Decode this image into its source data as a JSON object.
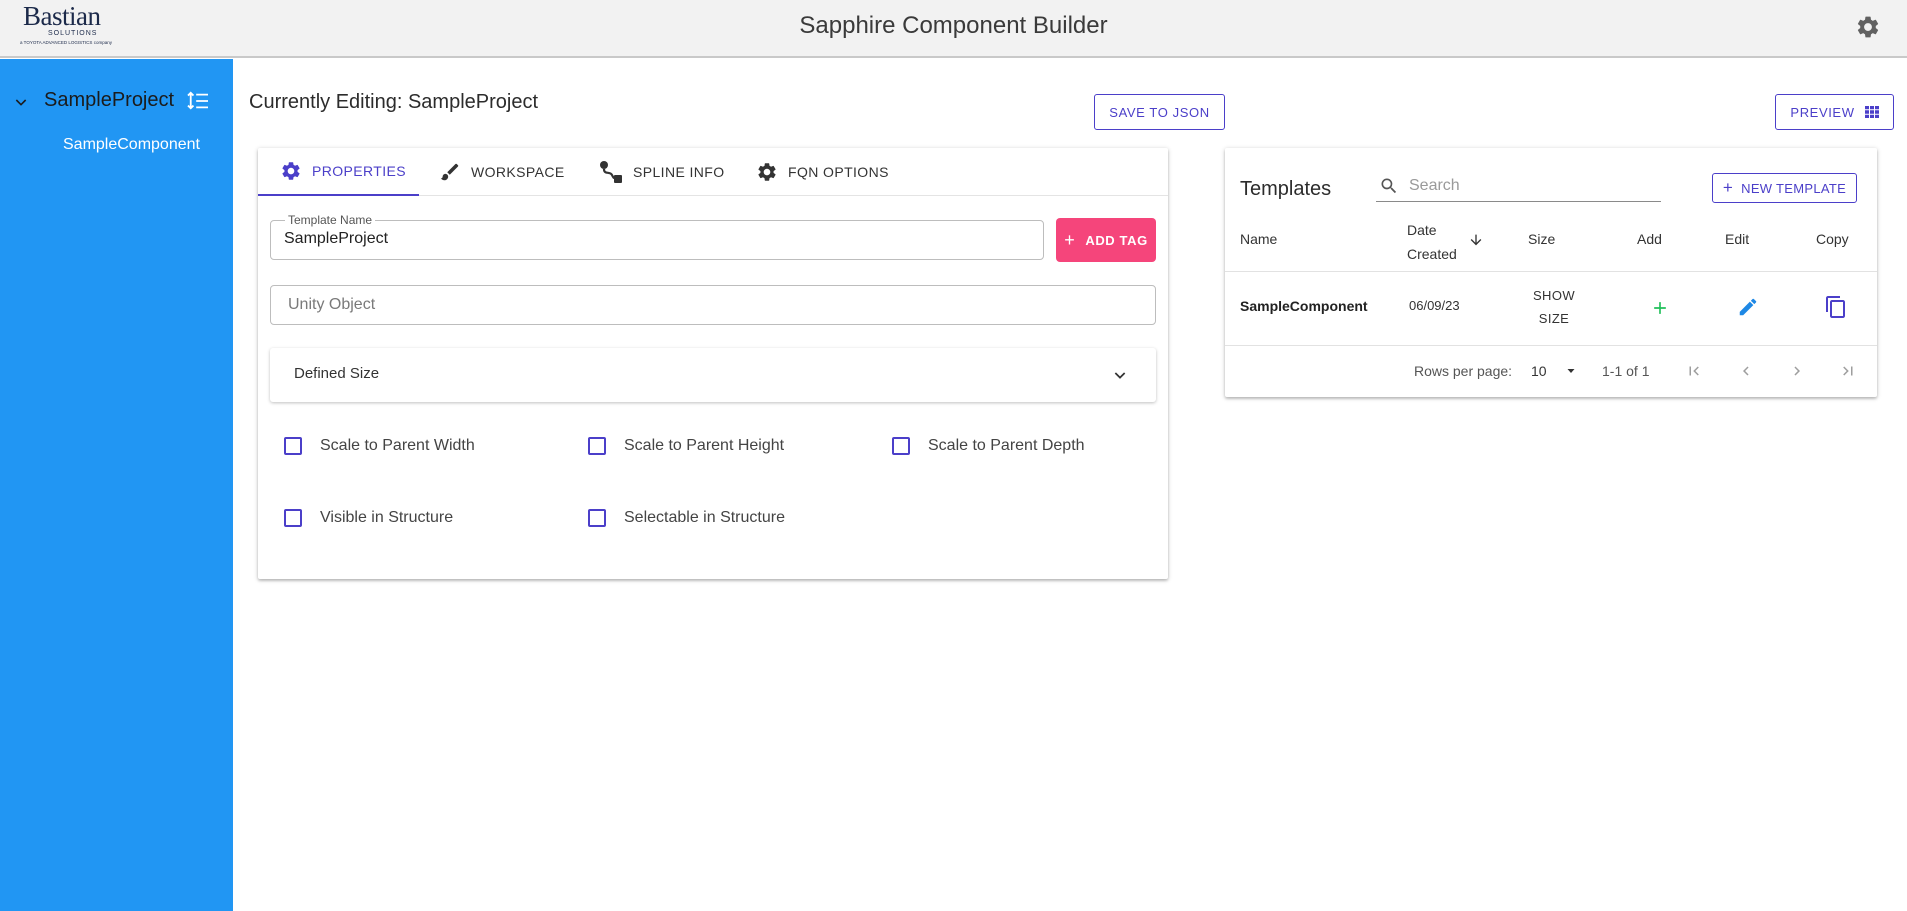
{
  "header": {
    "logo_word": "Bastian",
    "logo_sub": "SOLUTIONS",
    "logo_tag": "a TOYOTA ADVANCED LOGISTICS company",
    "title": "Sapphire Component Builder",
    "settings_icon": "gear-icon"
  },
  "sidebar": {
    "project": "SampleProject",
    "child": "SampleComponent"
  },
  "main": {
    "page_title": "Currently Editing: SampleProject",
    "save_json_label": "SAVE TO JSON",
    "preview_label": "PREVIEW"
  },
  "editor": {
    "tabs": [
      {
        "label": "PROPERTIES",
        "icon": "gear-icon",
        "active": true
      },
      {
        "label": "WORKSPACE",
        "icon": "brush-icon",
        "active": false
      },
      {
        "label": "SPLINE INFO",
        "icon": "spline-icon",
        "active": false
      },
      {
        "label": "FQN OPTIONS",
        "icon": "gear-icon",
        "active": false
      }
    ],
    "template_name_label": "Template Name",
    "template_name_value": "SampleProject",
    "add_tag_label": "ADD TAG",
    "unity_object_placeholder": "Unity Object",
    "defined_size_label": "Defined Size",
    "checkboxes": [
      {
        "label": "Scale to Parent Width",
        "checked": false
      },
      {
        "label": "Scale to Parent Height",
        "checked": false
      },
      {
        "label": "Scale to Parent Depth",
        "checked": false
      },
      {
        "label": "Visible in Structure",
        "checked": false
      },
      {
        "label": "Selectable in Structure",
        "checked": false
      }
    ]
  },
  "templates": {
    "title": "Templates",
    "search_placeholder": "Search",
    "new_template_label": "NEW TEMPLATE",
    "columns": {
      "name": "Name",
      "date_line1": "Date",
      "date_line2": "Created",
      "size": "Size",
      "add": "Add",
      "edit": "Edit",
      "copy": "Copy"
    },
    "rows": [
      {
        "name": "SampleComponent",
        "date": "06/09/23",
        "size_line1": "SHOW",
        "size_line2": "SIZE"
      }
    ],
    "pagination": {
      "rows_per_page_label": "Rows per page:",
      "rows_per_page": "10",
      "range": "1-1 of 1"
    }
  },
  "colors": {
    "accent": "#4b3fc9",
    "sidebar": "#2196f3",
    "add_tag": "#f5457b",
    "add_icon": "#21c05a",
    "edit_icon": "#1e88e5"
  }
}
